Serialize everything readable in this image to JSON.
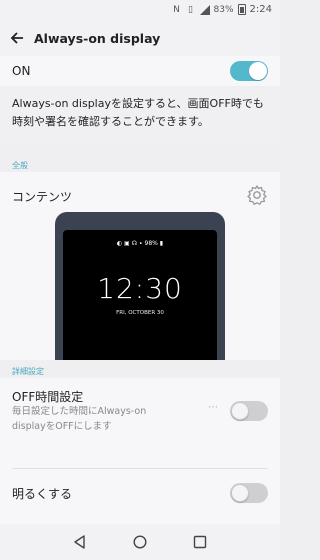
{
  "status_bar": {
    "battery_percent": "83%",
    "time": "2:24",
    "icons": [
      "nfc-icon",
      "vibrate-icon",
      "signal-icon",
      "battery-icon"
    ]
  },
  "app_bar": {
    "title": "Always-on display",
    "back_icon": "arrow-left-icon"
  },
  "main_toggle": {
    "label": "ON",
    "state": "on"
  },
  "description": "Always-on displayを設定すると、画面OFF時でも時刻や署名を確認することができます。",
  "sections": {
    "general_label": "全般",
    "detail_label": "詳細設定"
  },
  "contents": {
    "title": "コンテンツ",
    "preview": {
      "status_icons": "◐ ▣ ☊ ∙ 98% ▮",
      "time": "12:30",
      "date": "FRI, OCTOBER 30"
    }
  },
  "off_time": {
    "title": "OFF時間設定",
    "subtitle_line1": "毎日設定した時間にAlways-on",
    "subtitle_line2": "displayをOFFにします",
    "toggle_state": "off"
  },
  "brightness": {
    "title": "明るくする",
    "toggle_state": "off"
  },
  "colors": {
    "accent": "#54b8cc",
    "section_label": "#4aa8bd",
    "phone_frame": "#3b4252"
  },
  "nav_bar": [
    "back-icon",
    "home-icon",
    "recents-icon"
  ]
}
